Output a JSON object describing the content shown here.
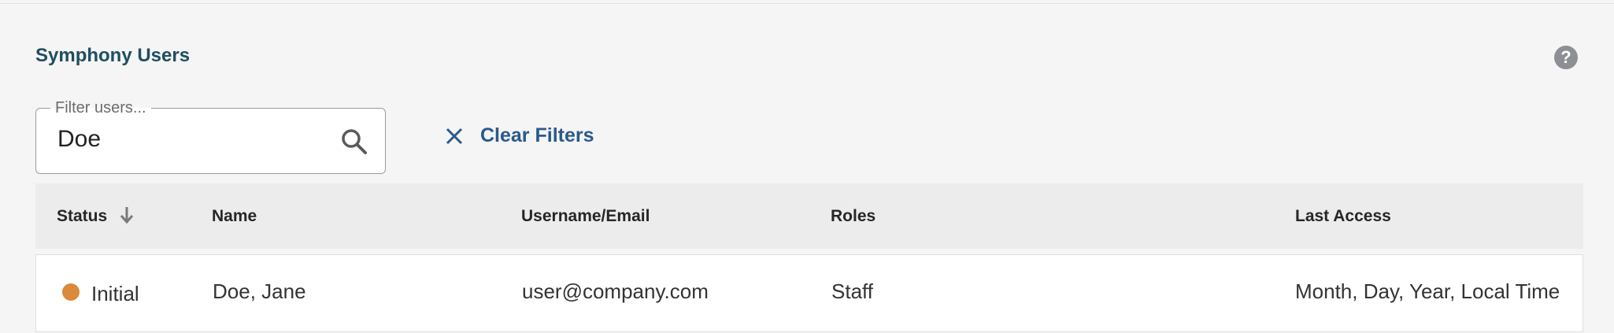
{
  "title": "Symphony Users",
  "help": {
    "icon": "help-circle-icon",
    "glyph": "?"
  },
  "filter": {
    "legend": "Filter users...",
    "value": "Doe",
    "search_icon": "search-icon"
  },
  "clear_filters": {
    "label": "Clear Filters",
    "icon": "close-icon"
  },
  "table": {
    "columns": {
      "status": "Status",
      "name": "Name",
      "username": "Username/Email",
      "roles": "Roles",
      "last_access": "Last Access"
    },
    "sort": {
      "column": "status",
      "direction": "descending",
      "icon": "arrow-down-icon"
    },
    "rows": [
      {
        "status": "Initial",
        "status_color": "#d98a3a",
        "name": "Doe, Jane",
        "username": "user@company.com",
        "roles": "Staff",
        "last_access": "Month, Day, Year, Local Time"
      }
    ]
  },
  "colors": {
    "title": "#1f4e5f",
    "link": "#2a5a8a",
    "header_bg": "#ececec",
    "background": "#f5f5f5"
  }
}
